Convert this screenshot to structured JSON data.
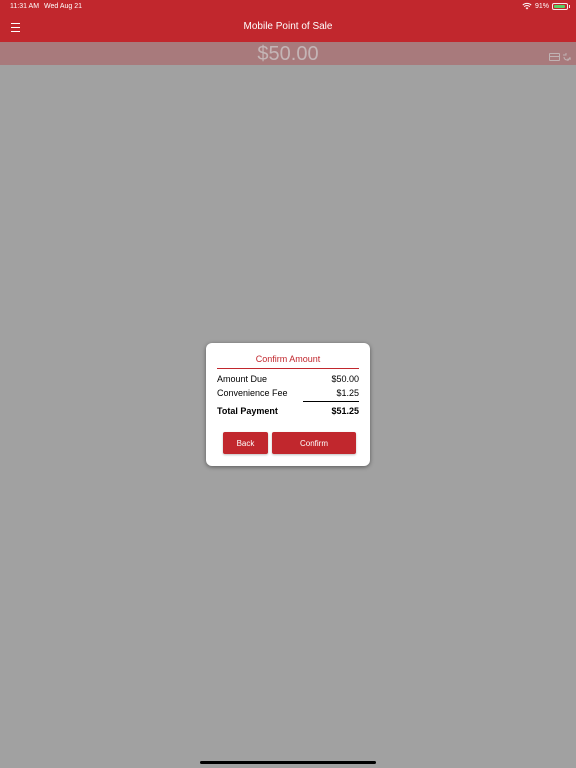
{
  "status_bar": {
    "time": "11:31 AM",
    "date": "Wed Aug 21",
    "battery_percent": "91%",
    "battery_level": 0.91,
    "icons": [
      "wifi-icon",
      "battery-icon"
    ],
    "battery_color": "#5bd064"
  },
  "nav": {
    "title": "Mobile Point of Sale",
    "menu_icon": "menu-icon"
  },
  "amount_bar": {
    "amount": "$50.00",
    "icons": [
      "card-icon",
      "tap-icon"
    ]
  },
  "modal": {
    "title": "Confirm Amount",
    "rows": [
      {
        "label": "Amount Due",
        "value": "$50.00"
      },
      {
        "label": "Convenience Fee",
        "value": "$1.25"
      }
    ],
    "total": {
      "label": "Total Payment",
      "value": "$51.25"
    },
    "back_label": "Back",
    "confirm_label": "Confirm"
  },
  "colors": {
    "brand": "#c1272d",
    "overlay": "#a1a1a1",
    "text": "#000000"
  }
}
